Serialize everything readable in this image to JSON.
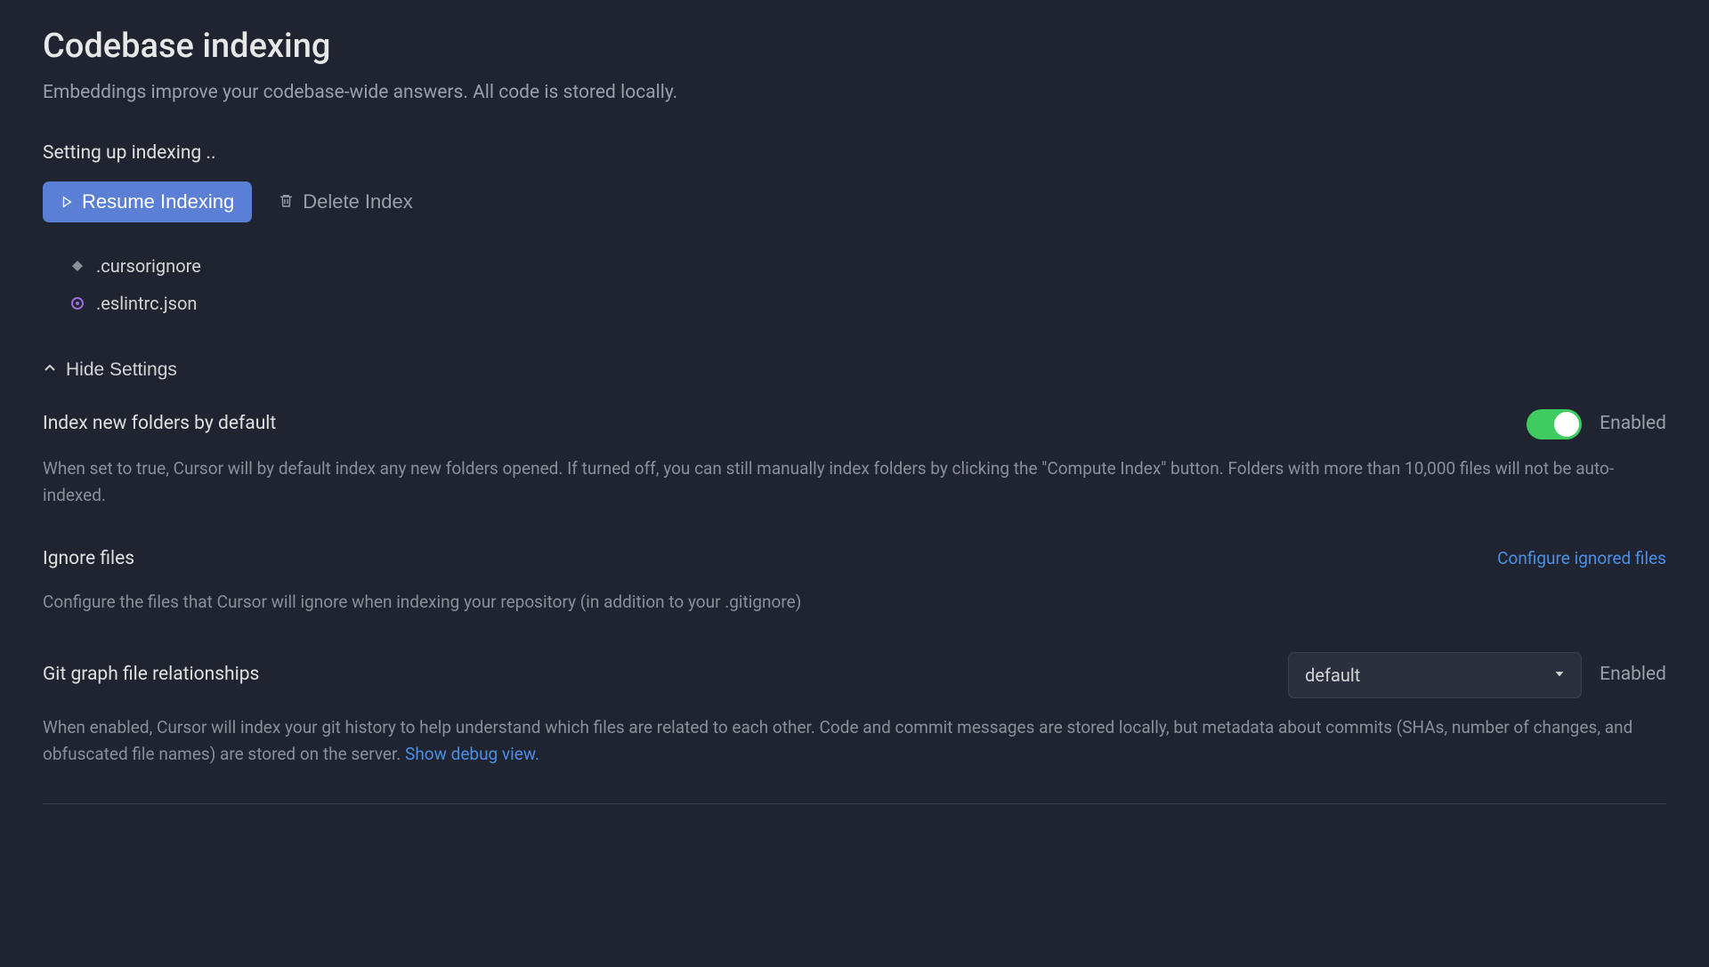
{
  "header": {
    "title": "Codebase indexing",
    "subtitle": "Embeddings improve your codebase-wide answers. All code is stored locally."
  },
  "status": "Setting up indexing ..",
  "actions": {
    "resume_label": "Resume Indexing",
    "delete_label": "Delete Index"
  },
  "files": [
    {
      "name": ".cursorignore",
      "icon": "diamond"
    },
    {
      "name": ".eslintrc.json",
      "icon": "eslint"
    }
  ],
  "toggle_settings_label": "Hide Settings",
  "settings": {
    "index_new_folders": {
      "title": "Index new folders by default",
      "status": "Enabled",
      "description": "When set to true, Cursor will by default index any new folders opened. If turned off, you can still manually index folders by clicking the \"Compute Index\" button. Folders with more than 10,000 files will not be auto-indexed."
    },
    "ignore_files": {
      "title": "Ignore files",
      "link_label": "Configure ignored files",
      "description": "Configure the files that Cursor will ignore when indexing your repository (in addition to your .gitignore)"
    },
    "git_graph": {
      "title": "Git graph file relationships",
      "selected": "default",
      "status": "Enabled",
      "description_part1": "When enabled, Cursor will index your git history to help understand which files are related to each other. Code and commit messages are stored locally, but metadata about commits (SHAs, number of changes, and obfuscated file names) are stored on the server. ",
      "link_label": "Show debug view."
    }
  }
}
